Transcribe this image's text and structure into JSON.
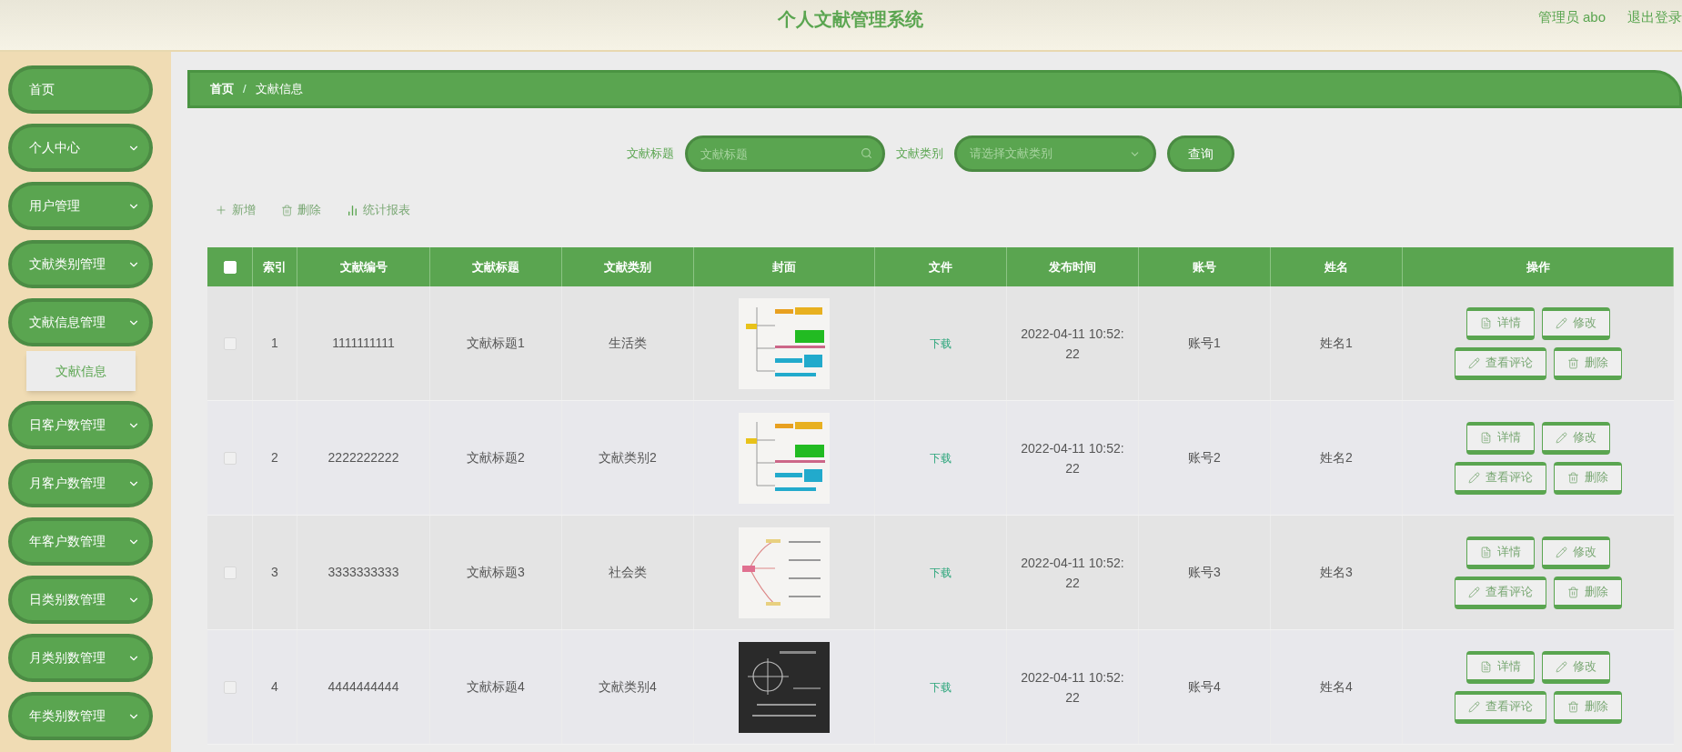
{
  "header": {
    "title": "个人文献管理系统",
    "user": "管理员 abo",
    "logout": "退出登录"
  },
  "sidebar": {
    "items": [
      {
        "kind": "link",
        "label": "首页"
      },
      {
        "kind": "group",
        "label": "个人中心"
      },
      {
        "kind": "group",
        "label": "用户管理"
      },
      {
        "kind": "group",
        "label": "文献类别管理"
      },
      {
        "kind": "group",
        "label": "文献信息管理",
        "children": [
          {
            "label": "文献信息"
          }
        ]
      },
      {
        "kind": "group",
        "label": "日客户数管理"
      },
      {
        "kind": "group",
        "label": "月客户数管理"
      },
      {
        "kind": "group",
        "label": "年客户数管理"
      },
      {
        "kind": "group",
        "label": "日类别数管理"
      },
      {
        "kind": "group",
        "label": "月类别数管理"
      },
      {
        "kind": "group",
        "label": "年类别数管理"
      }
    ]
  },
  "breadcrumb": [
    "首页",
    "文献信息"
  ],
  "breadcrumb_separator": "/",
  "search": {
    "title_label": "文献标题",
    "title_placeholder": "文献标题",
    "type_label": "文献类别",
    "type_placeholder": "请选择文献类别",
    "button": "查询"
  },
  "toolbar": [
    {
      "kind": "add",
      "label": "新增"
    },
    {
      "kind": "delete",
      "label": "删除"
    },
    {
      "kind": "chart",
      "label": "统计报表"
    }
  ],
  "table": {
    "select_all_checked": false,
    "columns": [
      "索引",
      "文献编号",
      "文献标题",
      "文献类别",
      "封面",
      "文件",
      "发布时间",
      "账号",
      "姓名",
      "操作"
    ],
    "rows": [
      {
        "checked": false,
        "index": "1",
        "number": "1111111111",
        "title": "文献标题1",
        "type": "生活类",
        "file": "下载",
        "time": "2022-04-11 10:52:22",
        "account": "账号1",
        "name": "姓名1",
        "actions": [
          {
            "kind": "detail",
            "label": "详情"
          },
          {
            "kind": "edit",
            "label": "修改"
          },
          {
            "kind": "comment",
            "label": "查看评论"
          },
          {
            "kind": "delete",
            "label": "删除"
          }
        ]
      },
      {
        "checked": false,
        "index": "2",
        "number": "2222222222",
        "title": "文献标题2",
        "type": "文献类别2",
        "file": "下载",
        "time": "2022-04-11 10:52:22",
        "account": "账号2",
        "name": "姓名2",
        "actions": [
          {
            "kind": "detail",
            "label": "详情"
          },
          {
            "kind": "edit",
            "label": "修改"
          },
          {
            "kind": "comment",
            "label": "查看评论"
          },
          {
            "kind": "delete",
            "label": "删除"
          }
        ]
      },
      {
        "checked": false,
        "index": "3",
        "number": "3333333333",
        "title": "文献标题3",
        "type": "社会类",
        "file": "下载",
        "time": "2022-04-11 10:52:22",
        "account": "账号3",
        "name": "姓名3",
        "actions": [
          {
            "kind": "detail",
            "label": "详情"
          },
          {
            "kind": "edit",
            "label": "修改"
          },
          {
            "kind": "comment",
            "label": "查看评论"
          },
          {
            "kind": "delete",
            "label": "删除"
          }
        ]
      },
      {
        "checked": false,
        "index": "4",
        "number": "4444444444",
        "title": "文献标题4",
        "type": "文献类别4",
        "file": "下载",
        "time": "2022-04-11 10:52:22",
        "account": "账号4",
        "name": "姓名4",
        "actions": [
          {
            "kind": "detail",
            "label": "详情"
          },
          {
            "kind": "edit",
            "label": "修改"
          },
          {
            "kind": "comment",
            "label": "查看评论"
          },
          {
            "kind": "delete",
            "label": "删除"
          }
        ]
      }
    ]
  }
}
